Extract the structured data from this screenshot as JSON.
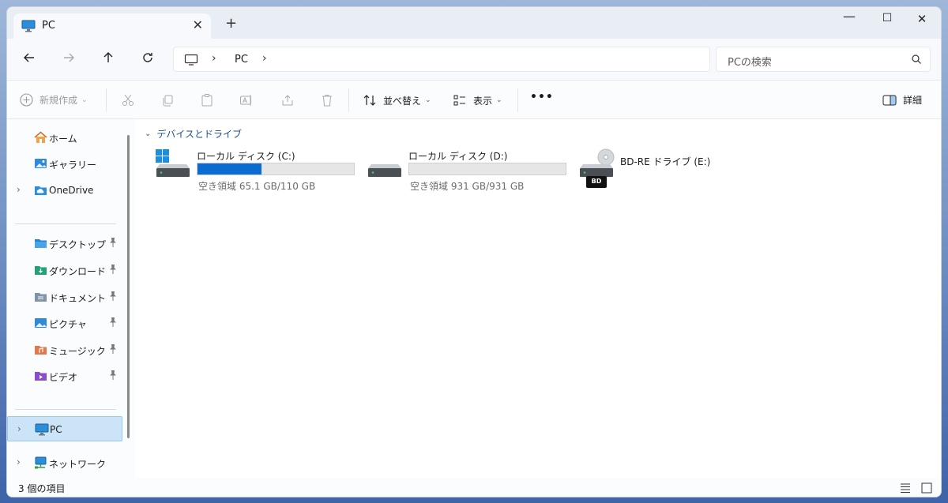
{
  "tab": {
    "title": "PC",
    "close_glyph": "✕",
    "new_tab_glyph": "+"
  },
  "window_controls": {
    "minimize": "—",
    "maximize": "☐",
    "close": "✕"
  },
  "nav": {
    "back_glyph": "←",
    "forward_glyph": "→",
    "up_glyph": "↑",
    "refresh_glyph": "↻",
    "breadcrumb": {
      "location": "PC",
      "chevron": "›"
    },
    "search": {
      "placeholder": "PCの検索"
    }
  },
  "commands": {
    "new": "新規作成",
    "sort": "並べ替え",
    "view": "表示",
    "more": "•••",
    "details": "詳細"
  },
  "sidebar": {
    "home": "ホーム",
    "gallery": "ギャラリー",
    "onedrive": "OneDrive",
    "desktop": "デスクトップ",
    "downloads": "ダウンロード",
    "documents": "ドキュメント",
    "pictures": "ピクチャ",
    "music": "ミュージック",
    "videos": "ビデオ",
    "pc": "PC",
    "network": "ネットワーク",
    "chevron": "›"
  },
  "main": {
    "group_title": "デバイスとドライブ",
    "group_chevron": "⌄",
    "drives": [
      {
        "name": "ローカル ディスク (C:)",
        "free": "空き領域 65.1 GB/110 GB",
        "used_fraction": 0.41
      },
      {
        "name": "ローカル ディスク (D:)",
        "free": "空き領域 931 GB/931 GB",
        "used_fraction": 0.0
      },
      {
        "name": "BD-RE ドライブ (E:)",
        "badge": "BD"
      }
    ]
  },
  "status": {
    "item_count": "3 個の項目"
  },
  "colors": {
    "accent": "#0a6cd0",
    "selection": "#cce4f7",
    "group_title": "#1e4f8c"
  }
}
